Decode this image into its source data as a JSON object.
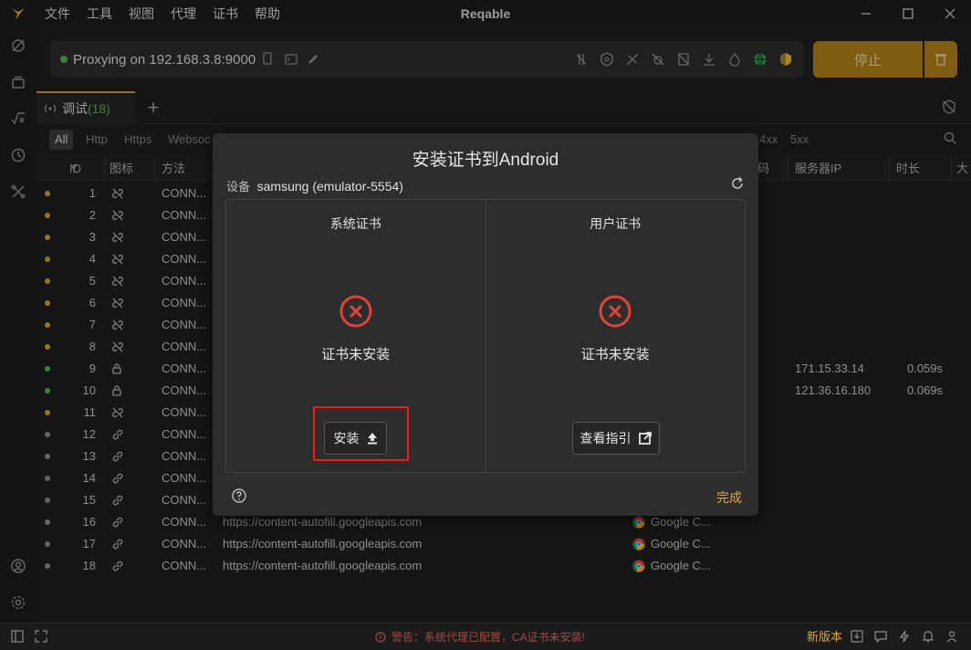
{
  "app": {
    "title": "Reqable",
    "menu": [
      "文件",
      "工具",
      "视图",
      "代理",
      "证书",
      "帮助"
    ]
  },
  "proxy": {
    "status_text": "Proxying on 192.168.3.8:9000",
    "stop_label": "停止"
  },
  "tabs": {
    "debug_label": "调试",
    "debug_count": "(18)"
  },
  "filters": [
    "All",
    "Http",
    "Https",
    "Websoc",
    "4xx",
    "5xx"
  ],
  "table": {
    "headers": [
      "ID",
      "图标",
      "方法",
      "码",
      "服务器IP",
      "时长",
      "大"
    ],
    "rows": [
      {
        "id": "1",
        "status": "yellow",
        "icon": "unlink",
        "method": "CONN...",
        "url": "",
        "app": "",
        "ip": "",
        "dur": ""
      },
      {
        "id": "2",
        "status": "yellow",
        "icon": "unlink",
        "method": "CONN...",
        "url": "",
        "app": "",
        "ip": "",
        "dur": ""
      },
      {
        "id": "3",
        "status": "yellow",
        "icon": "unlink",
        "method": "CONN...",
        "url": "",
        "app": "",
        "ip": "",
        "dur": ""
      },
      {
        "id": "4",
        "status": "yellow",
        "icon": "unlink",
        "method": "CONN...",
        "url": "",
        "app": "",
        "ip": "",
        "dur": ""
      },
      {
        "id": "5",
        "status": "yellow",
        "icon": "unlink",
        "method": "CONN...",
        "url": "",
        "app": "",
        "ip": "",
        "dur": ""
      },
      {
        "id": "6",
        "status": "yellow",
        "icon": "unlink",
        "method": "CONN...",
        "url": "",
        "app": "",
        "ip": "",
        "dur": ""
      },
      {
        "id": "7",
        "status": "yellow",
        "icon": "unlink",
        "method": "CONN...",
        "url": "",
        "app": "",
        "ip": "",
        "dur": ""
      },
      {
        "id": "8",
        "status": "yellow",
        "icon": "unlink",
        "method": "CONN...",
        "url": "",
        "app": "",
        "ip": "",
        "dur": ""
      },
      {
        "id": "9",
        "status": "green",
        "icon": "lock",
        "method": "CONN...",
        "url": "",
        "app": "",
        "ip": "171.15.33.14",
        "dur": "0.059s"
      },
      {
        "id": "10",
        "status": "green",
        "icon": "lock",
        "method": "CONN...",
        "url": "",
        "app": "",
        "ip": "121.36.16.180",
        "dur": "0.069s"
      },
      {
        "id": "11",
        "status": "yellow",
        "icon": "unlink",
        "method": "CONN...",
        "url": "",
        "app": "",
        "ip": "",
        "dur": ""
      },
      {
        "id": "12",
        "status": "grey",
        "icon": "link",
        "method": "CONN...",
        "url": "",
        "app": "",
        "ip": "",
        "dur": ""
      },
      {
        "id": "13",
        "status": "grey",
        "icon": "link",
        "method": "CONN...",
        "url": "",
        "app": "",
        "ip": "",
        "dur": ""
      },
      {
        "id": "14",
        "status": "grey",
        "icon": "link",
        "method": "CONN...",
        "url": "",
        "app": "",
        "ip": "",
        "dur": ""
      },
      {
        "id": "15",
        "status": "grey",
        "icon": "link",
        "method": "CONN...",
        "url": "",
        "app": "",
        "ip": "",
        "dur": ""
      },
      {
        "id": "16",
        "status": "grey",
        "icon": "link",
        "method": "CONN...",
        "url": "https://content-autofill.googleapis.com",
        "app": "Google C...",
        "ip": "",
        "dur": ""
      },
      {
        "id": "17",
        "status": "grey",
        "icon": "link",
        "method": "CONN...",
        "url": "https://content-autofill.googleapis.com",
        "app": "Google C...",
        "ip": "",
        "dur": ""
      },
      {
        "id": "18",
        "status": "grey",
        "icon": "link",
        "method": "CONN...",
        "url": "https://content-autofill.googleapis.com",
        "app": "Google C...",
        "ip": "",
        "dur": ""
      }
    ]
  },
  "dialog": {
    "title": "安装证书到Android",
    "device_label": "设备",
    "device_name": "samsung (emulator-5554)",
    "system_cert": {
      "title": "系统证书",
      "status": "证书未安装",
      "button": "安装"
    },
    "user_cert": {
      "title": "用户证书",
      "status": "证书未安装",
      "button": "查看指引"
    },
    "done_label": "完成"
  },
  "statusbar": {
    "warning": "警告：系统代理已配置，CA证书未安装!",
    "new_version": "新版本"
  },
  "colors": {
    "accent": "#a87b17",
    "done": "#e0a63a",
    "error": "#e0443a",
    "highlight": "#e0231e",
    "status_yellow": "#c9a227",
    "status_green": "#4caf50",
    "status_grey": "#8a8a8a"
  }
}
